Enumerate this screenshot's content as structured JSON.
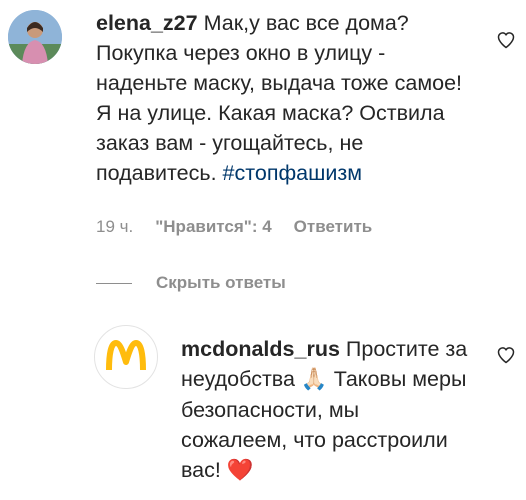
{
  "comments": [
    {
      "username": "elena_z27",
      "text": "Мак,у вас все дома? Покупка через окно в улицу - наденьте маску, выдача тоже самое! Я на улице. Какая маска? Оствила заказ вам - угощайтесь, не подавитесь.",
      "hashtag": "#стопфашизм",
      "time": "19 ч.",
      "likes": "\"Нравится\": 4",
      "reply": "Ответить",
      "avatar_icon": "user-avatar"
    },
    {
      "username": "mcdonalds_rus",
      "text": "Простите за неудобства",
      "emoji_pray": "🙏🏻",
      "text_after": "Таковы меры безопасности, мы сожалеем, что расстроили вас!",
      "emoji_heart": "❤️",
      "avatar_icon": "mcdonalds-logo"
    }
  ],
  "hide_replies": "Скрыть ответы",
  "colors": {
    "text": "#262626",
    "meta": "#8e8e8e",
    "hashtag": "#00376b",
    "brand_yellow": "#ffbc0d",
    "heart_red": "#e0245e"
  },
  "icons": {
    "like": "heart-outline-icon"
  }
}
